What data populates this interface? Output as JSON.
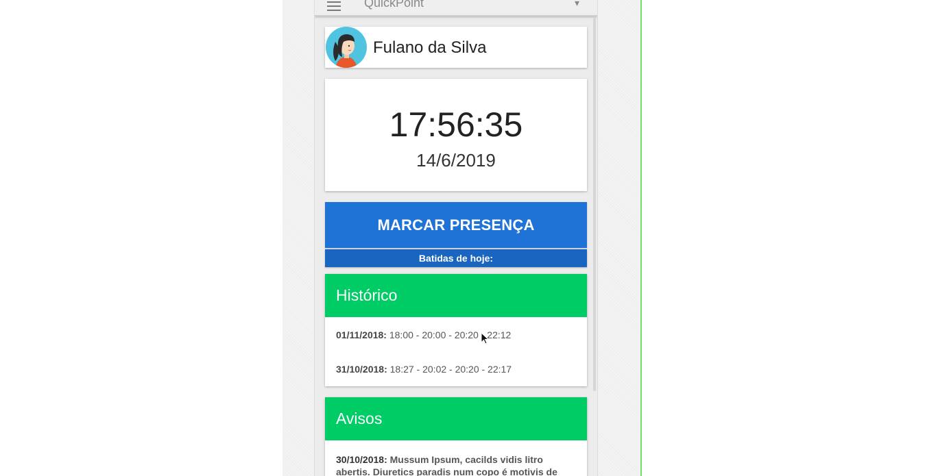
{
  "app": {
    "title": "QuickPoint",
    "menu_icon": "menu-icon",
    "more_icon": "more-vert-icon"
  },
  "user": {
    "name": "Fulano da Silva",
    "avatar_icon": "female-avatar-icon"
  },
  "clock": {
    "time": "17:56:35",
    "date": "14/6/2019"
  },
  "actions": {
    "mark_presence": "MARCAR PRESENÇA",
    "today_punches": "Batidas de hoje:"
  },
  "history": {
    "title": "Histórico",
    "entries": [
      {
        "date": "01/11/2018:",
        "times": "18:00 - 20:00 - 20:20 - 22:12"
      },
      {
        "date": "31/10/2018:",
        "times": "18:27 - 20:02 - 20:20 - 22:17"
      }
    ]
  },
  "notices": {
    "title": "Avisos",
    "entries": [
      {
        "date": "30/10/2018:",
        "text": "Mussum Ipsum, cacilds vidis litro abertis. Diuretics paradis num copo é motivis de denguis."
      }
    ]
  },
  "colors": {
    "primary_blue": "#1f73d6",
    "dark_blue": "#1a65bf",
    "green": "#00cc66"
  }
}
